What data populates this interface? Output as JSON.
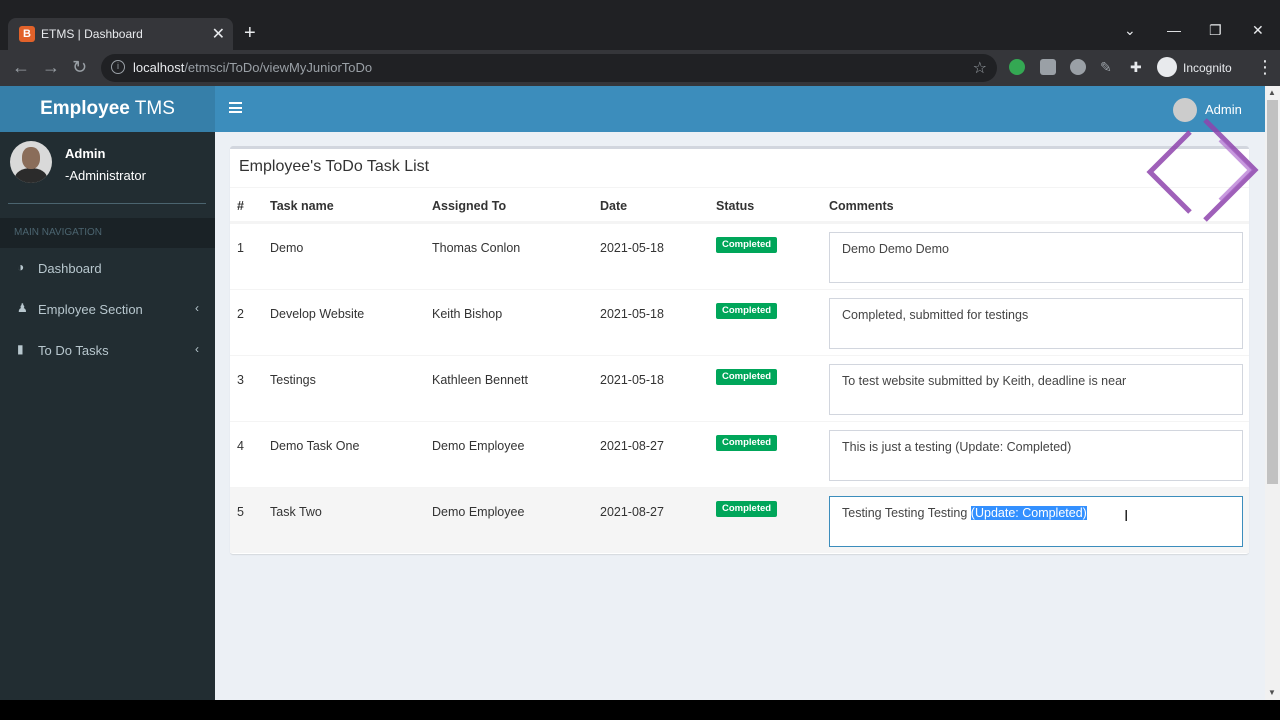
{
  "browser": {
    "tab_title": "ETMS | Dashboard",
    "favicon_letter": "B",
    "url_host": "localhost",
    "url_path": "/etmsci/ToDo/viewMyJuniorToDo",
    "incognito_label": "Incognito"
  },
  "app": {
    "logo_bold": "Employee",
    "logo_rest": " TMS",
    "navbar_user": "Admin",
    "sidebar": {
      "user_name": "Admin",
      "user_role": "-Administrator",
      "header": "MAIN NAVIGATION",
      "items": [
        {
          "label": "Dashboard",
          "icon": "dashboard-icon"
        },
        {
          "label": "Employee Section",
          "icon": "users-icon"
        },
        {
          "label": "To Do Tasks",
          "icon": "file-icon"
        }
      ]
    },
    "box_title": "Employee's ToDo Task List",
    "columns": [
      "#",
      "Task name",
      "Assigned To",
      "Date",
      "Status",
      "Comments"
    ],
    "rows": [
      {
        "num": "1",
        "task": "Demo",
        "assigned": "Thomas Conlon",
        "date": "2021-05-18",
        "status": "Completed",
        "comment": "Demo Demo Demo"
      },
      {
        "num": "2",
        "task": "Develop Website",
        "assigned": "Keith Bishop",
        "date": "2021-05-18",
        "status": "Completed",
        "comment": "Completed, submitted for testings"
      },
      {
        "num": "3",
        "task": "Testings",
        "assigned": "Kathleen Bennett",
        "date": "2021-05-18",
        "status": "Completed",
        "comment": "To test website submitted by Keith, deadline is near"
      },
      {
        "num": "4",
        "task": "Demo Task One",
        "assigned": "Demo Employee",
        "date": "2021-08-27",
        "status": "Completed",
        "comment": "This is just a testing (Update: Completed)"
      },
      {
        "num": "5",
        "task": "Task Two",
        "assigned": "Demo Employee",
        "date": "2021-08-27",
        "status": "Completed",
        "comment_pre": "Testing Testing Testing ",
        "comment_selected": "(Update: Completed)"
      }
    ],
    "colors": {
      "navbar": "#3c8dbc",
      "logo_bg": "#367fa9",
      "sidebar": "#222d32",
      "badge": "#00a65a"
    }
  }
}
